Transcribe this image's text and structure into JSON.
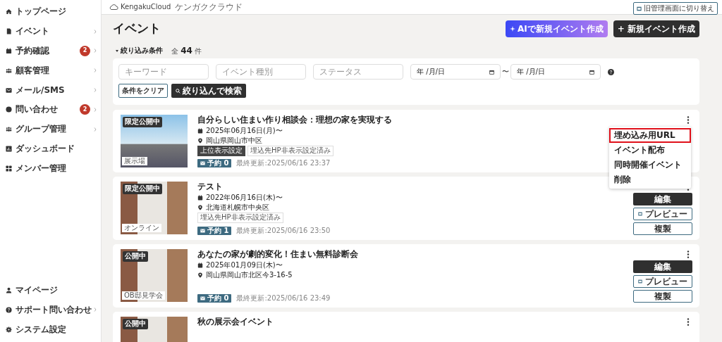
{
  "sidebar": {
    "items": [
      {
        "label": "トップページ",
        "arrow": false
      },
      {
        "label": "イベント",
        "arrow": true
      },
      {
        "label": "予約確認",
        "badge": "2",
        "arrow": true
      },
      {
        "label": "顧客管理",
        "arrow": true
      },
      {
        "label": "メール/SMS",
        "arrow": true
      },
      {
        "label": "問い合わせ",
        "badge": "2",
        "arrow": true
      },
      {
        "label": "グループ管理",
        "arrow": true
      },
      {
        "label": "ダッシュボード",
        "arrow": false
      },
      {
        "label": "メンバー管理",
        "arrow": false
      }
    ],
    "bottom_items": [
      {
        "label": "マイページ",
        "arrow": false
      },
      {
        "label": "サポート問い合わせ",
        "arrow": true
      },
      {
        "label": "システム設定",
        "arrow": false
      }
    ]
  },
  "header": {
    "logo": "KengakuCloud",
    "logo_sub": "ケンガククラウド",
    "switch_button": "旧管理画面に切り替え"
  },
  "page_title": "イベント",
  "actions": {
    "ai_button": "AIで新規イベント作成",
    "new_button": "+ 新規イベント作成"
  },
  "filter": {
    "toggle": "絞り込み条件",
    "total_prefix": "全",
    "total": "44",
    "total_suffix": "件",
    "fields": [
      {
        "placeholder": "キーワード",
        "kind": "text"
      },
      {
        "placeholder": "イベント種別",
        "kind": "text"
      },
      {
        "placeholder": "ステータス",
        "kind": "text"
      },
      {
        "value": "年 /月/日",
        "kind": "date"
      },
      {
        "value": "年 /月/日",
        "kind": "date"
      }
    ],
    "range_sep": "〜",
    "clear_button": "条件をクリア",
    "search_button": "絞り込んで検索"
  },
  "events": [
    {
      "status": "限定公開中",
      "category": "展示場",
      "title": "自分らしい住まい作り相談会：理想の家を実現する",
      "date": "2025年06月16日(月)〜",
      "place": "岡山県岡山市中区",
      "tags": [
        {
          "label": "上位表示設定",
          "dark": true
        },
        {
          "label": "埋込先HP非表示設定済み",
          "dark": false
        }
      ],
      "reservations": "予約 0",
      "updated": "最終更新:2025/06/16 23:37",
      "menu_open": true
    },
    {
      "status": "限定公開中",
      "category": "オンライン",
      "title": "テスト",
      "date": "2022年06月16日(木)〜",
      "place": "北海道札幌市中央区",
      "tags": [
        {
          "label": "埋込先HP非表示設定済み",
          "dark": false
        }
      ],
      "reservations": "予約 1",
      "updated": "最終更新:2025/06/16 23:50",
      "menu_open": false,
      "buttons": [
        "編集",
        "プレビュー",
        "複製"
      ]
    },
    {
      "status": "公開中",
      "category": "OB邸見学会",
      "title": "あなたの家が劇的変化！住まい無料診断会",
      "date": "2025年01月09日(木)〜",
      "place": "岡山県岡山市北区今3-16-5",
      "reservations": "予約 0",
      "updated": "最終更新:2025/06/16 23:49",
      "menu_open": false,
      "buttons": [
        "編集",
        "プレビュー",
        "複製"
      ]
    },
    {
      "status": "公開中",
      "title": "秋の展示会イベント",
      "menu_open": false
    }
  ],
  "menu": {
    "items": [
      {
        "label": "埋め込み用URL",
        "selected": true
      },
      {
        "label": "イベント配布",
        "selected": false
      },
      {
        "label": "同時開催イベント",
        "selected": false
      },
      {
        "label": "削除",
        "selected": false
      }
    ]
  }
}
